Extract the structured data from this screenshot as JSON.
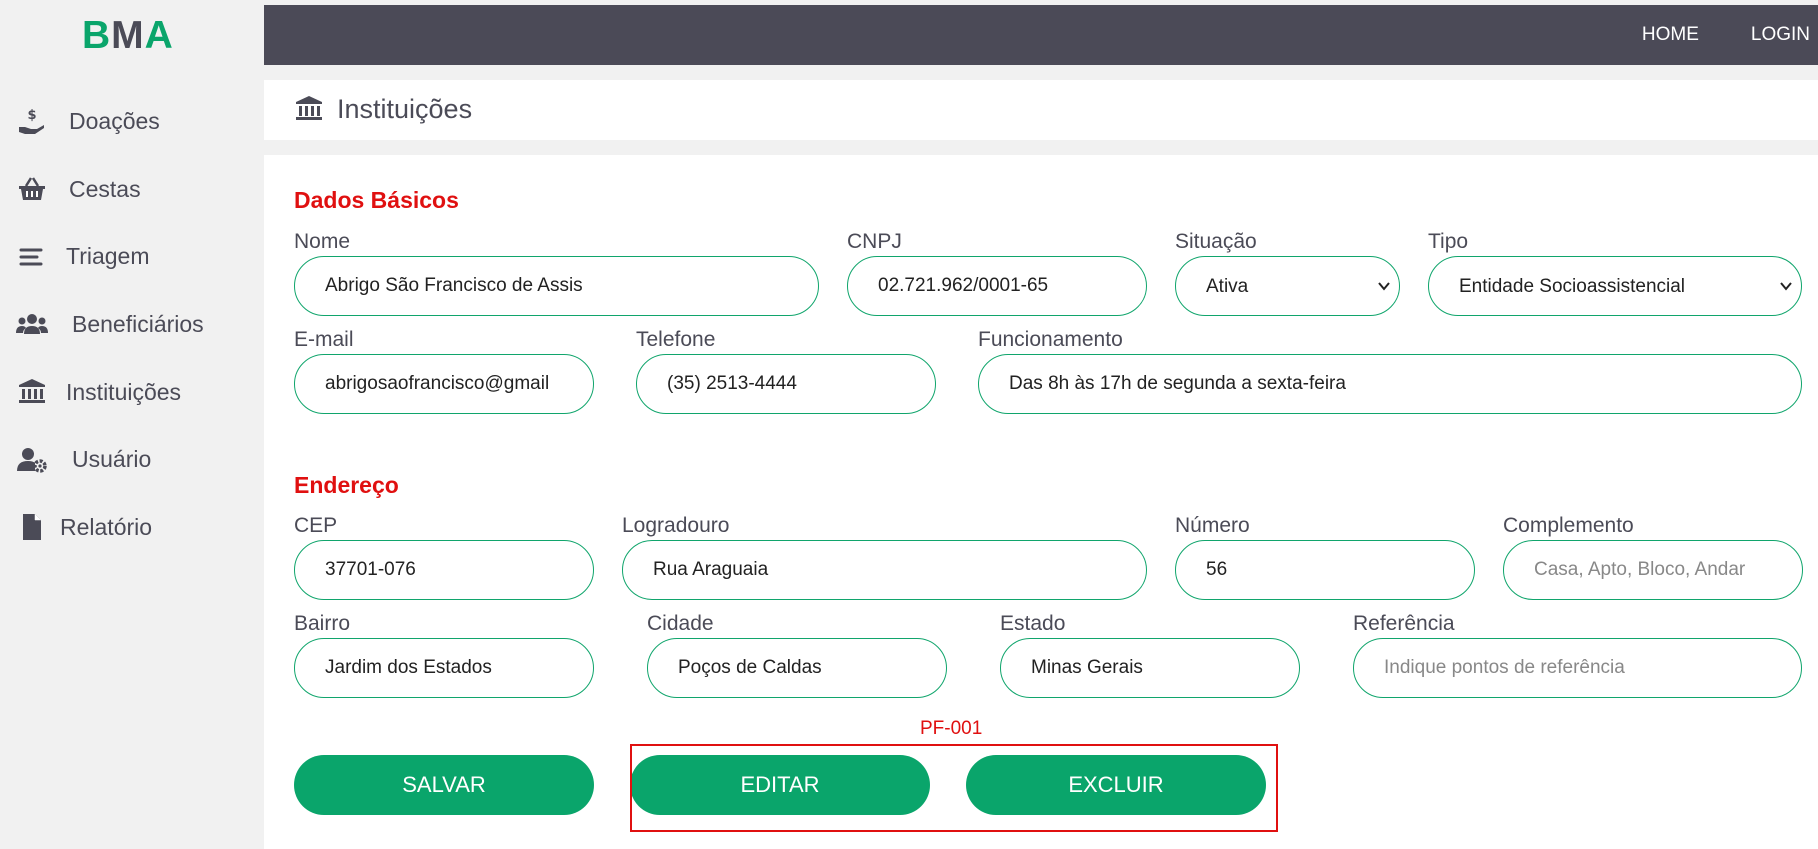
{
  "brand": {
    "letters": [
      "B",
      "M",
      "A"
    ]
  },
  "sidebar": {
    "items": [
      {
        "label": "Doações",
        "icon": "hand-holding-dollar-icon"
      },
      {
        "label": "Cestas",
        "icon": "basket-icon"
      },
      {
        "label": "Triagem",
        "icon": "list-lines-icon"
      },
      {
        "label": "Beneficiários",
        "icon": "users-icon"
      },
      {
        "label": "Instituições",
        "icon": "institution-icon"
      },
      {
        "label": "Usuário",
        "icon": "user-gear-icon"
      },
      {
        "label": "Relatório",
        "icon": "file-icon"
      }
    ]
  },
  "topnav": {
    "home": "HOME",
    "login": "LOGIN"
  },
  "page": {
    "title": "Instituições",
    "icon": "institution-icon"
  },
  "sections": {
    "basic": "Dados Básicos",
    "address": "Endereço"
  },
  "form": {
    "nome": {
      "label": "Nome",
      "value": "Abrigo São Francisco de Assis"
    },
    "cnpj": {
      "label": "CNPJ",
      "value": "02.721.962/0001-65"
    },
    "situacao": {
      "label": "Situação",
      "value": "Ativa"
    },
    "tipo": {
      "label": "Tipo",
      "value": "Entidade Socioassistencial"
    },
    "email": {
      "label": "E-mail",
      "value": "abrigosaofrancisco@gmail"
    },
    "telefone": {
      "label": "Telefone",
      "value": "(35) 2513-4444"
    },
    "funcionamento": {
      "label": "Funcionamento",
      "value": "Das 8h às 17h de segunda a sexta-feira"
    },
    "cep": {
      "label": "CEP",
      "value": "37701-076"
    },
    "logradouro": {
      "label": "Logradouro",
      "value": "Rua Araguaia"
    },
    "numero": {
      "label": "Número",
      "value": "56"
    },
    "complemento": {
      "label": "Complemento",
      "value": "",
      "placeholder": "Casa, Apto, Bloco, Andar"
    },
    "bairro": {
      "label": "Bairro",
      "value": "Jardim dos Estados"
    },
    "cidade": {
      "label": "Cidade",
      "value": "Poços de Caldas"
    },
    "estado": {
      "label": "Estado",
      "value": "Minas Gerais"
    },
    "referencia": {
      "label": "Referência",
      "value": "",
      "placeholder": "Indique pontos de referência"
    }
  },
  "buttons": {
    "salvar": "SALVAR",
    "editar": "EDITAR",
    "excluir": "EXCLUIR"
  },
  "annotation": {
    "label": "PF-001"
  },
  "colors": {
    "accent": "#0aa56b",
    "topbar": "#4b4a57",
    "section_title": "#e01010",
    "annotation": "#e01010"
  }
}
